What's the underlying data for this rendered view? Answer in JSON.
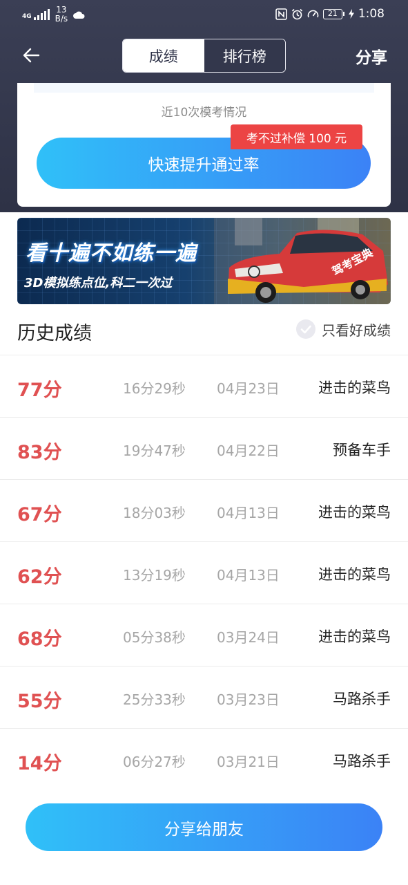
{
  "status_bar": {
    "network": "4G",
    "net_speed_value": "13",
    "net_speed_unit": "B/s",
    "battery": "21",
    "time": "1:08",
    "icons": [
      "nfc-icon",
      "alarm-icon",
      "speedometer-icon",
      "battery-icon",
      "charging-icon"
    ]
  },
  "nav": {
    "tabs": [
      {
        "label": "成绩",
        "active": true
      },
      {
        "label": "排行榜",
        "active": false
      }
    ],
    "share": "分享"
  },
  "card": {
    "caption": "近10次模考情况",
    "improve_button": "快速提升通过率",
    "compensation_badge": "考不过补偿 100 元"
  },
  "banner": {
    "headline": "看十遍不如练一遍",
    "subline": "3D模拟练点位,科二一次过",
    "car_brand": "驾考宝典"
  },
  "history": {
    "title": "历史成绩",
    "filter_label": "只看好成绩",
    "rows": [
      {
        "score": "77分",
        "duration": "16分29秒",
        "date": "04月23日",
        "title": "进击的菜鸟"
      },
      {
        "score": "83分",
        "duration": "19分47秒",
        "date": "04月22日",
        "title": "预备车手"
      },
      {
        "score": "67分",
        "duration": "18分03秒",
        "date": "04月13日",
        "title": "进击的菜鸟"
      },
      {
        "score": "62分",
        "duration": "13分19秒",
        "date": "04月13日",
        "title": "进击的菜鸟"
      },
      {
        "score": "68分",
        "duration": "05分38秒",
        "date": "03月24日",
        "title": "进击的菜鸟"
      },
      {
        "score": "55分",
        "duration": "25分33秒",
        "date": "03月23日",
        "title": "马路杀手"
      },
      {
        "score": "14分",
        "duration": "06分27秒",
        "date": "03月21日",
        "title": "马路杀手"
      }
    ]
  },
  "share_button": "分享给朋友",
  "colors": {
    "header_bg": "#33374c",
    "score_red": "#e05152",
    "badge_red": "#ec4444",
    "button_gradient_start": "#30c0f8",
    "button_gradient_end": "#3b82f6"
  }
}
